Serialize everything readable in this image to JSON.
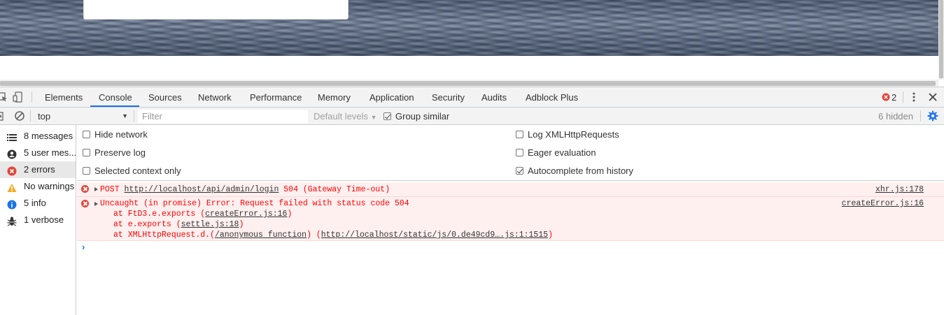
{
  "devtools": {
    "tabs": [
      "Elements",
      "Console",
      "Sources",
      "Network",
      "Performance",
      "Memory",
      "Application",
      "Security",
      "Audits",
      "Adblock Plus"
    ],
    "active_tab": "Console",
    "error_count": "2"
  },
  "toolbar": {
    "context": "top",
    "filter_placeholder": "Filter",
    "levels_label": "Default levels",
    "group_similar_label": "Group similar",
    "group_similar_checked": true,
    "hidden_label": "6 hidden"
  },
  "sidebar": {
    "items": [
      {
        "label": "8 messages",
        "icon": "list-icon"
      },
      {
        "label": "5 user mes...",
        "icon": "user-icon"
      },
      {
        "label": "2 errors",
        "icon": "error-icon",
        "selected": true
      },
      {
        "label": "No warnings",
        "icon": "warning-icon"
      },
      {
        "label": "5 info",
        "icon": "info-icon"
      },
      {
        "label": "1 verbose",
        "icon": "bug-icon"
      }
    ]
  },
  "settings": {
    "hide_network": {
      "label": "Hide network",
      "checked": false
    },
    "preserve_log": {
      "label": "Preserve log",
      "checked": false
    },
    "selected_context_only": {
      "label": "Selected context only",
      "checked": false
    },
    "log_xhr": {
      "label": "Log XMLHttpRequests",
      "checked": false
    },
    "eager_evaluation": {
      "label": "Eager evaluation",
      "checked": false
    },
    "autocomplete_history": {
      "label": "Autocomplete from history",
      "checked": true
    }
  },
  "messages": [
    {
      "method": "POST",
      "url": "http://localhost/api/admin/login",
      "status": "504 (Gateway Time-out)",
      "source": "xhr.js:178"
    },
    {
      "text": "Uncaught (in promise) Error: Request failed with status code 504",
      "source": "createError.js:16",
      "stack": [
        {
          "prefix": "at FtD3.e.exports (",
          "link": "createError.js:16",
          "suffix": ")"
        },
        {
          "prefix": "at e.exports (",
          "link": "settle.js:18",
          "suffix": ")"
        },
        {
          "prefix": "at XMLHttpRequest.d.(",
          "link": "/anonymous function",
          "mid": ") (",
          "link2": "http://localhost/static/js/0.de49cd9….js:1:1515",
          "suffix": ")"
        }
      ]
    }
  ],
  "colors": {
    "accent": "#1a73e8",
    "error": "#ff0000",
    "error_bg": "#fff0f0"
  }
}
